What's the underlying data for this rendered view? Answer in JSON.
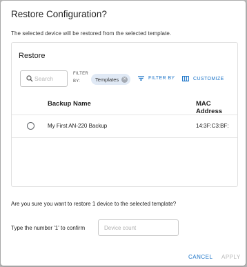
{
  "dialog": {
    "title": "Restore Configuration?",
    "subtitle": "The selected device will be restored from the selected template."
  },
  "panel": {
    "title": "Restore",
    "search": {
      "placeholder": "Search"
    },
    "filter_by_label": "FILTER BY:",
    "filter_chip": "Templates",
    "filter_by_button": "FILTER BY",
    "customize_button": "CUSTOMIZE",
    "table": {
      "columns": [
        "Backup Name",
        "MAC Address"
      ],
      "rows": [
        {
          "backup_name": "My First AN-220 Backup",
          "mac_address": "14:3F:C3:BF:"
        }
      ]
    }
  },
  "confirm": {
    "question": "Are you sure you want to restore 1 device to the selected template?",
    "label": "Type the number '1' to confirm",
    "input_placeholder": "Device count"
  },
  "buttons": {
    "cancel": "CANCEL",
    "apply": "APPLY"
  },
  "colors": {
    "accent": "#1a73c8",
    "chip_bg": "#e0e9f5",
    "disabled": "#b5b5b5"
  }
}
